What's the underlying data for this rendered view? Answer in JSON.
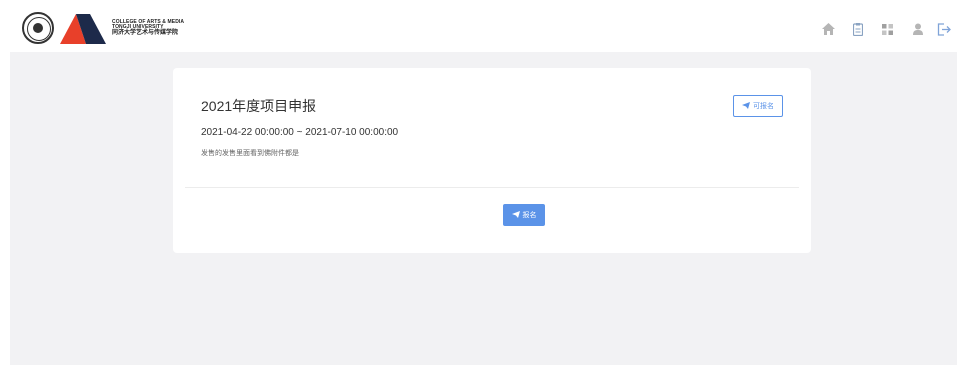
{
  "header": {
    "logo_en_line1": "COLLEGE OF ARTS & MEDIA",
    "logo_en_line2": "TONGJI UNIVERSITY",
    "logo_cn": "同济大学艺术与传媒学院",
    "nav_icons": [
      "home-icon",
      "document-icon",
      "grid-icon",
      "user-icon",
      "logout-icon"
    ]
  },
  "project": {
    "title": "2021年度项目申报",
    "date_range": "2021-04-22 00:00:00 ~ 2021-07-10 00:00:00",
    "description": "发售的发售里面看到佛附件都是",
    "status_label": "可报名",
    "apply_label": "报名"
  },
  "colors": {
    "accent": "#5b93e8",
    "background": "#f2f2f4",
    "card": "#ffffff",
    "logo_red": "#e8402a",
    "logo_navy": "#1d2a4a"
  }
}
